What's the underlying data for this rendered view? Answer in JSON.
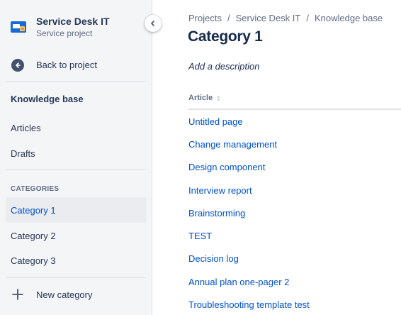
{
  "project": {
    "name": "Service Desk IT",
    "type": "Service project",
    "avatar_colors": [
      "#1868db",
      "#f5cd47",
      "#e774bb"
    ]
  },
  "sidebar": {
    "back_label": "Back to project",
    "section_title": "Knowledge base",
    "items": [
      {
        "label": "Articles"
      },
      {
        "label": "Drafts"
      }
    ],
    "categories_heading": "CATEGORIES",
    "categories": [
      {
        "label": "Category 1",
        "selected": true
      },
      {
        "label": "Category 2",
        "selected": false
      },
      {
        "label": "Category 3",
        "selected": false
      }
    ],
    "new_category_label": "New category"
  },
  "breadcrumb": [
    "Projects",
    "Service Desk IT",
    "Knowledge base"
  ],
  "breadcrumb_separator": "/",
  "page": {
    "title": "Category 1",
    "description_placeholder": "Add a description"
  },
  "table": {
    "column_header": "Article",
    "rows": [
      "Untitled page",
      "Change management",
      "Design component",
      "Interview report",
      "Brainstorming",
      "TEST",
      "Decision log",
      "Annual plan one-pager 2",
      "Troubleshooting template test"
    ]
  },
  "colors": {
    "link": "#0052cc",
    "sidebar_bg": "#f4f5f7",
    "selected_bg": "#ebecf0",
    "text": "#172b4d"
  },
  "icons": {
    "back": "arrow-left-circle-icon",
    "collapse": "chevron-left-icon",
    "add": "plus-icon",
    "sort": "sort-icon"
  }
}
